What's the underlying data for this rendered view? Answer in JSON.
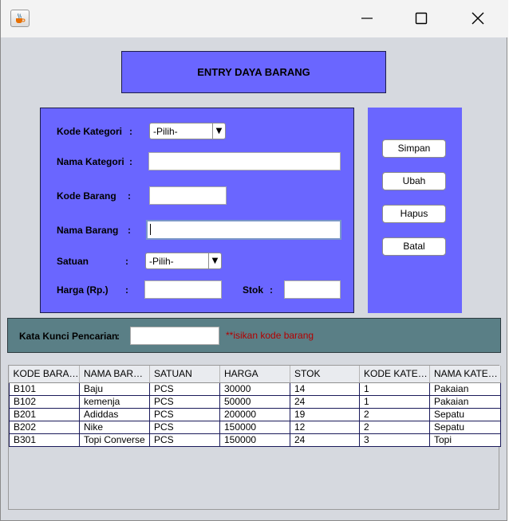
{
  "header": {
    "title": "ENTRY DAYA BARANG"
  },
  "form": {
    "kode_kategori": {
      "label": "Kode Kategori",
      "colon": ":",
      "value": "-Pilih-"
    },
    "nama_kategori": {
      "label": "Nama Kategori",
      "colon": ":",
      "value": ""
    },
    "kode_barang": {
      "label": "Kode Barang",
      "colon": ":",
      "value": ""
    },
    "nama_barang": {
      "label": "Nama Barang",
      "colon": ":",
      "value": ""
    },
    "satuan": {
      "label": "Satuan",
      "colon": ":",
      "value": "-Pilih-"
    },
    "harga": {
      "label": "Harga (Rp.)",
      "colon": ":",
      "value": ""
    },
    "stok": {
      "label": "Stok",
      "colon": ":",
      "value": ""
    }
  },
  "buttons": {
    "simpan": "Simpan",
    "ubah": "Ubah",
    "hapus": "Hapus",
    "batal": "Batal"
  },
  "search": {
    "label": "Kata Kunci Pencarian",
    "colon": ":",
    "value": "",
    "hint": "**isikan kode barang"
  },
  "table": {
    "columns": [
      "KODE BARANG",
      "NAMA BARANG",
      "SATUAN",
      "HARGA",
      "STOK",
      "KODE KATEGORI",
      "NAMA KATEGORI"
    ],
    "rows": [
      [
        "B101",
        "Baju",
        "PCS",
        "30000",
        "14",
        "1",
        "Pakaian"
      ],
      [
        "B102",
        "kemenja",
        "PCS",
        "50000",
        "24",
        "1",
        "Pakaian"
      ],
      [
        "B201",
        "Adiddas",
        "PCS",
        "200000",
        "19",
        "2",
        "Sepatu"
      ],
      [
        "B202",
        "Nike",
        "PCS",
        "150000",
        "12",
        "2",
        "Sepatu"
      ],
      [
        "B301",
        "Topi Converse",
        "PCS",
        "150000",
        "24",
        "3",
        "Topi"
      ]
    ]
  },
  "icons": {
    "app": "java-cup-icon",
    "minimize": "minimize-icon",
    "maximize": "maximize-icon",
    "close": "close-icon",
    "dropdown": "chevron-down-icon"
  },
  "colors": {
    "panel": "#6a66ff",
    "search_panel": "#5a7f86",
    "hint": "#b30000"
  }
}
